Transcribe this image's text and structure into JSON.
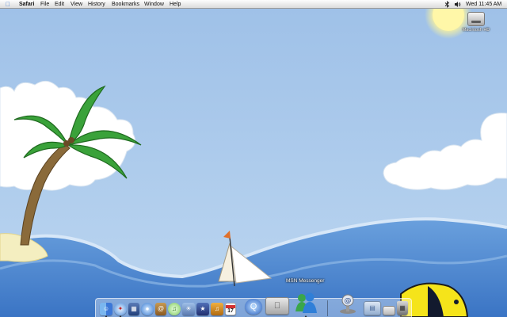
{
  "menubar": {
    "apple_icon": "apple-icon",
    "app_name": "Safari",
    "menus": [
      "File",
      "Edit",
      "View",
      "History",
      "Bookmarks",
      "Window",
      "Help"
    ],
    "bluetooth_icon": "bluetooth-icon",
    "volume_icon": "volume-icon",
    "clock": "Wed 11:45 AM",
    "spotlight_icon": "spotlight-icon"
  },
  "desktop": {
    "disk_label": "Macintosh HD",
    "disk_icon": "hard-disk-icon"
  },
  "dock": {
    "tooltip": "MSN Messenger",
    "items": [
      {
        "name": "finder",
        "icon": "finder-icon"
      },
      {
        "name": "safari",
        "icon": "safari-icon"
      },
      {
        "name": "preview",
        "icon": "preview-icon"
      },
      {
        "name": "ichat",
        "icon": "ichat-icon"
      },
      {
        "name": "address-book",
        "icon": "address-book-icon"
      },
      {
        "name": "itunes",
        "icon": "itunes-icon"
      },
      {
        "name": "iphoto",
        "icon": "iphoto-icon"
      },
      {
        "name": "imovie",
        "icon": "imovie-icon"
      },
      {
        "name": "garageband",
        "icon": "garageband-icon"
      },
      {
        "name": "ical",
        "icon": "ical-icon",
        "badge": "17"
      },
      {
        "name": "quicktime",
        "icon": "quicktime-icon"
      },
      {
        "name": "system-preferences",
        "icon": "system-preferences-icon"
      },
      {
        "name": "msn-messenger",
        "icon": "msn-messenger-icon"
      },
      {
        "name": "mail",
        "icon": "mail-icon"
      },
      {
        "name": "documents-folder",
        "icon": "folder-icon"
      },
      {
        "name": "trash",
        "icon": "trash-icon"
      }
    ]
  }
}
